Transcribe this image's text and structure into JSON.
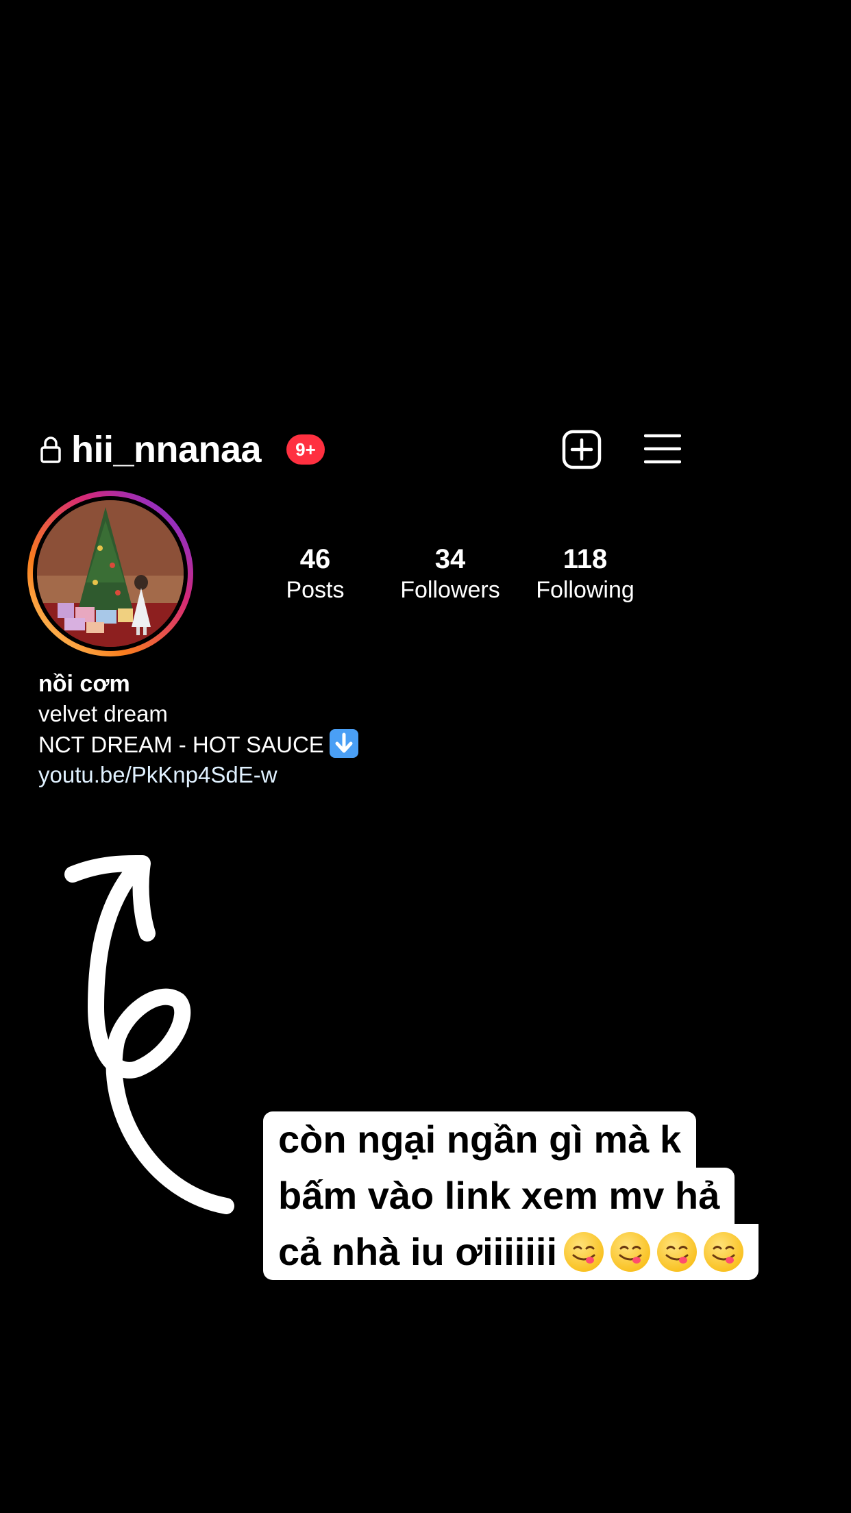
{
  "header": {
    "username": "hii_nnanaa",
    "badge": "9+"
  },
  "stats": [
    {
      "value": "46",
      "label": "Posts"
    },
    {
      "value": "34",
      "label": "Followers"
    },
    {
      "value": "118",
      "label": "Following"
    }
  ],
  "bio": {
    "name": "nồi cơm",
    "line1": "velvet dream",
    "line2": "NCT DREAM - HOT SAUCE",
    "link": "youtu.be/PkKnp4SdE-w"
  },
  "caption": {
    "line1": "còn ngại ngần gì mà k",
    "line2": "bấm vào link xem mv hả",
    "line3": "cả nhà iu ơiiiiiii"
  },
  "icons": {
    "lock": "lock-icon",
    "add": "plus-square-icon",
    "menu": "hamburger-menu-icon",
    "download": "down-arrow-emoji-icon",
    "emoji": "yum-face-emoji-icon",
    "arrow": "hand-drawn-arrow"
  },
  "colors": {
    "background": "#000000",
    "badge": "#ff3040",
    "caption_bg": "#ffffff"
  }
}
